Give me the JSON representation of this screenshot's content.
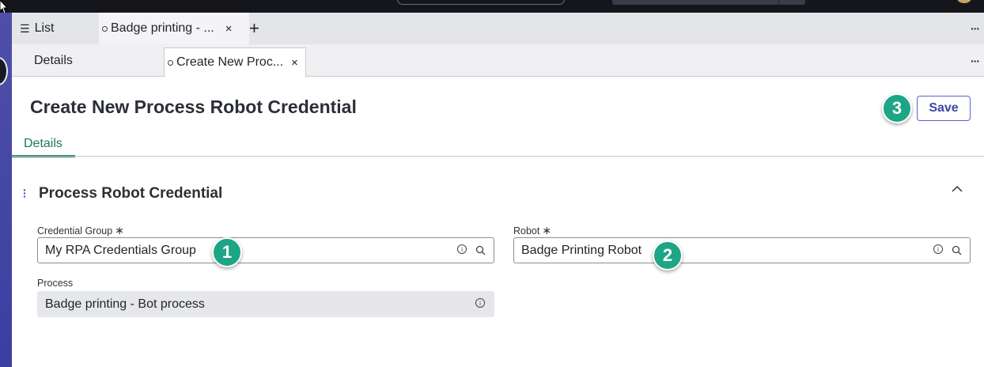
{
  "tabs_top": {
    "list_label": "List",
    "badge_tab_label": "Badge printing - ...",
    "close_glyph": "×",
    "add_glyph": "+",
    "more_glyph": "···"
  },
  "tabs_sub": {
    "details_label": "Details",
    "create_tab_label": "Create New Proc...",
    "close_glyph": "×",
    "more_glyph": "···"
  },
  "page": {
    "title": "Create New Process Robot Credential",
    "save_label": "Save",
    "subtab_details": "Details",
    "section_title": "Process Robot Credential"
  },
  "form": {
    "credential_group": {
      "label": "Credential Group",
      "required": "∗",
      "value": "My RPA Credentials Group"
    },
    "robot": {
      "label": "Robot",
      "required": "∗",
      "value": "Badge Printing Robot"
    },
    "process": {
      "label": "Process",
      "value": "Badge printing - Bot process"
    }
  },
  "annotations": {
    "one": "1",
    "two": "2",
    "three": "3"
  },
  "colors": {
    "accent_green": "#1ea586",
    "save_blue": "#3b47a8",
    "tab_green": "#1e7b53"
  },
  "icons": [
    "list-icon",
    "circle-icon",
    "close-icon",
    "plus-icon",
    "more-icon",
    "drag-handle-icon",
    "chevron-up-icon",
    "info-icon",
    "search-icon"
  ]
}
